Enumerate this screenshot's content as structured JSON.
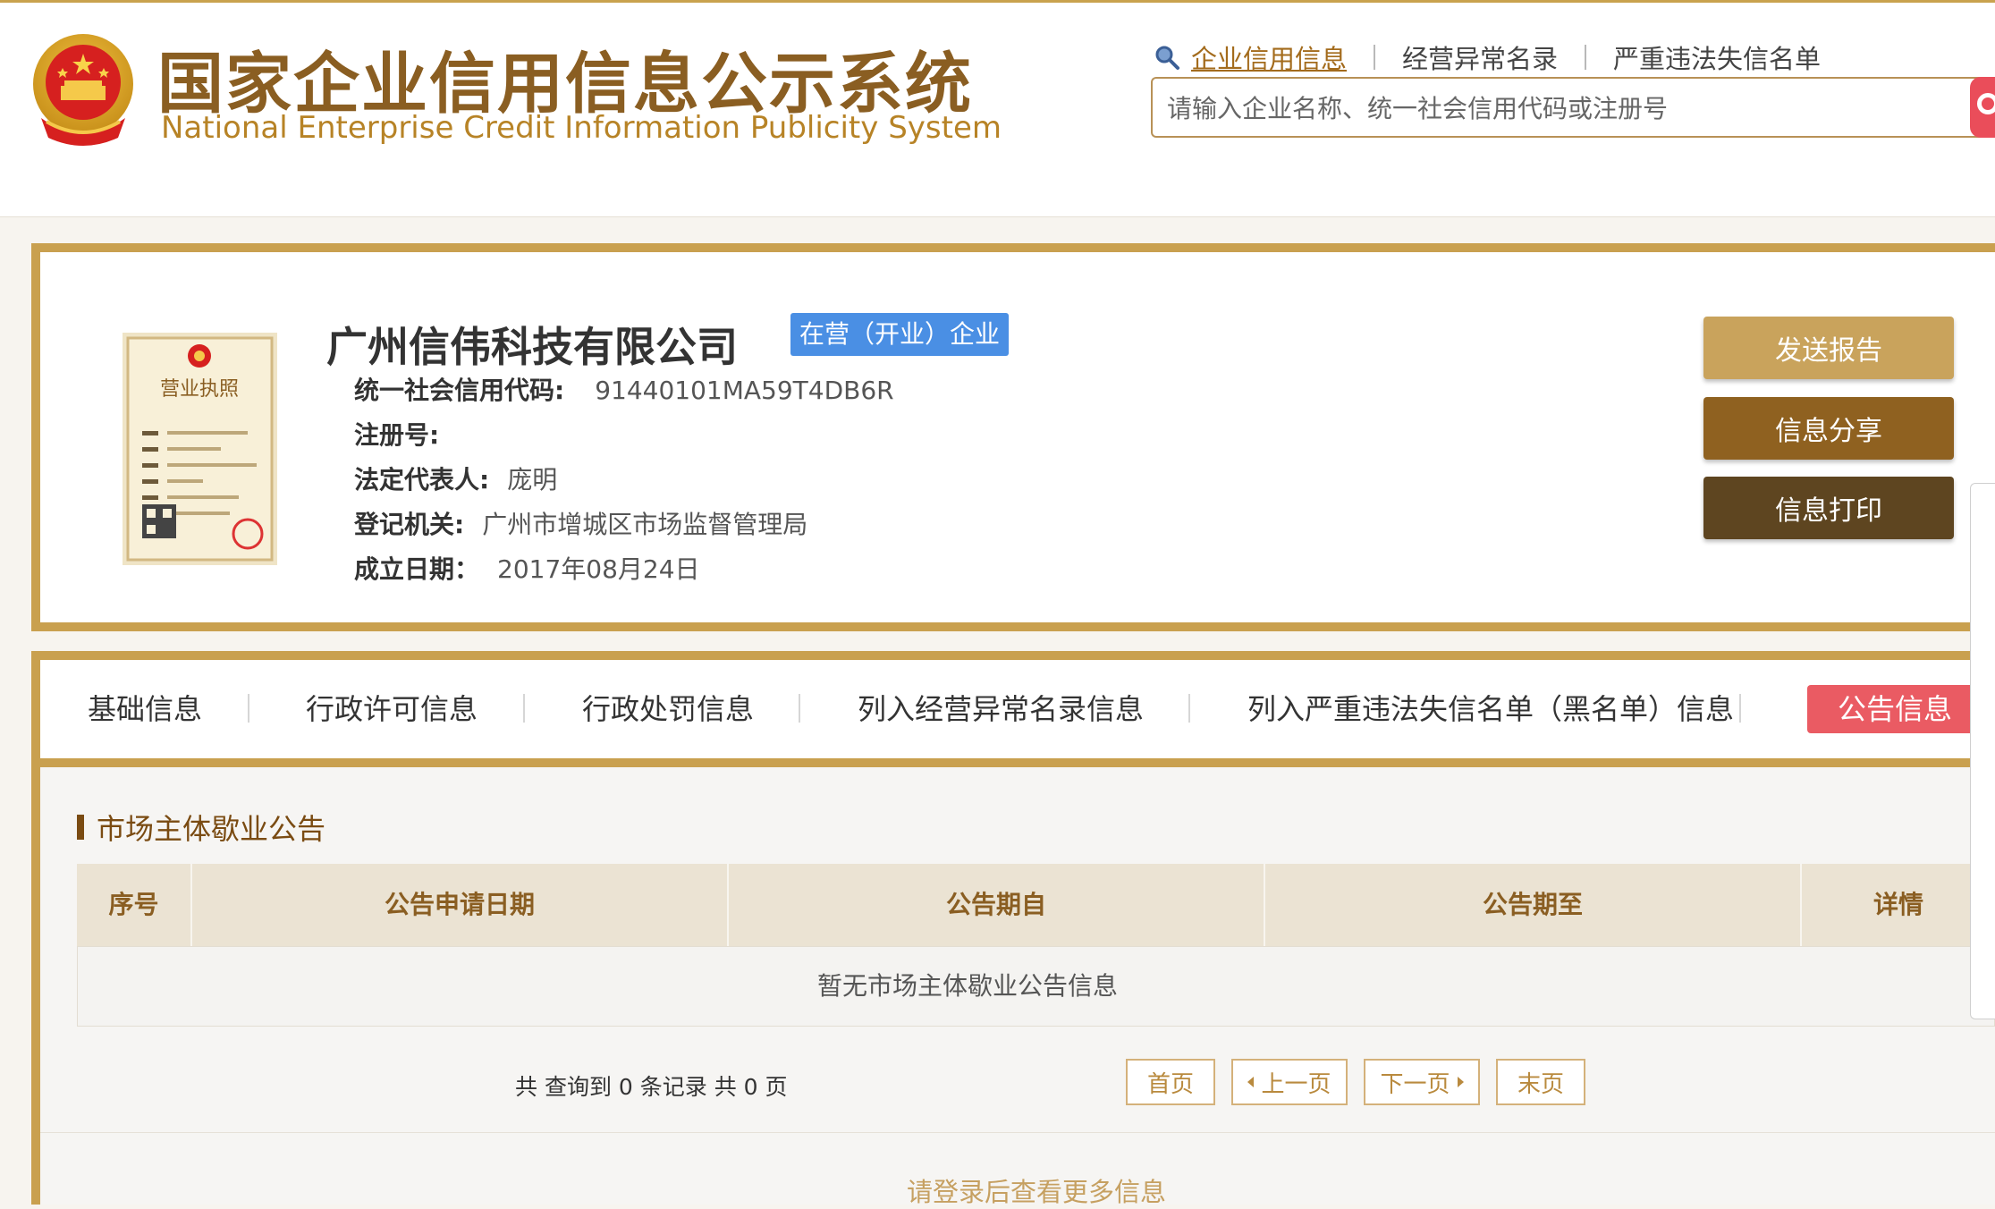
{
  "header": {
    "title_cn": "国家企业信用信息公示系统",
    "title_en": "National Enterprise Credit Information Publicity System",
    "nav_links": [
      "企业信用信息",
      "经营异常名录",
      "严重违法失信名单"
    ],
    "search_placeholder": "请输入企业名称、统一社会信用代码或注册号"
  },
  "company": {
    "name": "广州信伟科技有限公司",
    "status": "在营（开业）企业",
    "fields": [
      {
        "label": "统一社会信用代码:",
        "value": "91440101MA59T4DB6R"
      },
      {
        "label": "注册号:",
        "value": ""
      },
      {
        "label": "法定代表人:",
        "value": "庞明"
      },
      {
        "label": "登记机关:",
        "value": "广州市增城区市场监督管理局"
      },
      {
        "label": "成立日期：",
        "value": "2017年08月24日"
      }
    ],
    "license_image_title": "营业执照"
  },
  "actions": {
    "send_report": "发送报告",
    "share": "信息分享",
    "print": "信息打印"
  },
  "tabs": [
    "基础信息",
    "行政许可信息",
    "行政处罚信息",
    "列入经营异常名录信息",
    "列入严重违法失信名单（黑名单）信息",
    "公告信息"
  ],
  "active_tab": "公告信息",
  "section": {
    "title": "市场主体歇业公告",
    "columns": [
      "序号",
      "公告申请日期",
      "公告期自",
      "公告期至",
      "详情"
    ],
    "empty_message": "暂无市场主体歇业公告信息"
  },
  "pagination": {
    "summary": "共 查询到 0 条记录 共 0 页",
    "first": "首页",
    "prev": "上一页",
    "next": "下一页",
    "last": "末页"
  },
  "login_prompt": "请登录后查看更多信息",
  "colors": {
    "gold": "#c9a04f",
    "brown_dark": "#5e4520",
    "brown_mid": "#8f6120",
    "gold_light": "#c9a35c",
    "active_tab": "#ea5b63",
    "status_badge": "#4a8fe4"
  }
}
